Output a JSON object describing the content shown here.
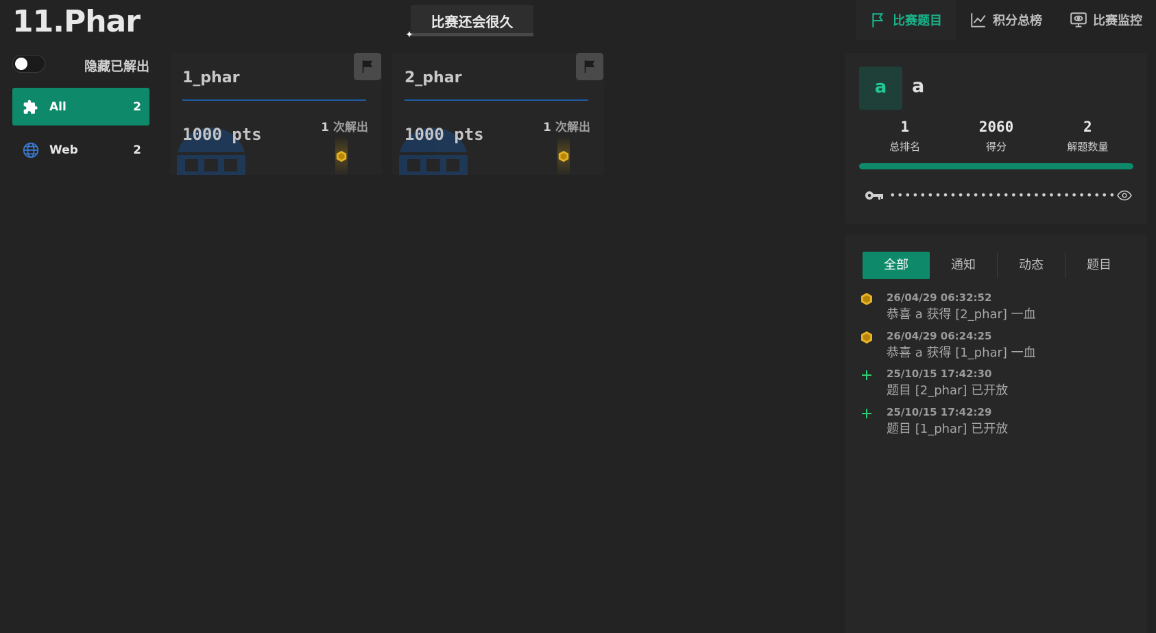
{
  "header": {
    "game_title": "11.Phar",
    "countdown_text": "比赛还会很久",
    "nav": [
      {
        "label": "比赛题目",
        "icon": "flag-icon",
        "active": true
      },
      {
        "label": "积分总榜",
        "icon": "chart-line-icon",
        "active": false
      },
      {
        "label": "比赛监控",
        "icon": "monitor-eye-icon",
        "active": false
      }
    ]
  },
  "sidebar": {
    "hide_solved_label": "隐藏已解出",
    "hide_solved_on": false,
    "categories": [
      {
        "label": "All",
        "count": "2",
        "icon": "puzzle-icon",
        "active": true
      },
      {
        "label": "Web",
        "count": "2",
        "icon": "globe-icon",
        "active": false
      }
    ]
  },
  "challenges": [
    {
      "name": "1_phar",
      "points": "1000 pts",
      "solves": "1",
      "solves_label": "次解出",
      "category_icon": "web-bridge-icon"
    },
    {
      "name": "2_phar",
      "points": "1000 pts",
      "solves": "1",
      "solves_label": "次解出",
      "category_icon": "web-bridge-icon"
    }
  ],
  "user": {
    "avatar_letter": "a",
    "name": "a",
    "stats": [
      {
        "value": "1",
        "label": "总排名"
      },
      {
        "value": "2060",
        "label": "得分"
      },
      {
        "value": "2",
        "label": "解题数量"
      }
    ],
    "progress": 1.0,
    "token_masked": "••••••••••••••••••••••••••••••"
  },
  "notices": {
    "tabs": [
      "全部",
      "通知",
      "动态",
      "题目"
    ],
    "active_tab": "全部",
    "items": [
      {
        "type": "first-blood",
        "time": "26/04/29 06:32:52",
        "text": "恭喜 a 获得 [2_phar] 一血"
      },
      {
        "type": "first-blood",
        "time": "26/04/29 06:24:25",
        "text": "恭喜 a 获得 [1_phar] 一血"
      },
      {
        "type": "new-challenge",
        "time": "25/10/15 17:42:30",
        "text": "题目 [2_phar] 已开放"
      },
      {
        "type": "new-challenge",
        "time": "25/10/15 17:42:29",
        "text": "题目 [1_phar] 已开放"
      }
    ]
  },
  "colors": {
    "accent": "#0e8a6b",
    "accent_text": "#19b38a",
    "medal": "#e6b422",
    "new_challenge": "#2ecc71",
    "divider_blue": "#1e5ba3"
  }
}
